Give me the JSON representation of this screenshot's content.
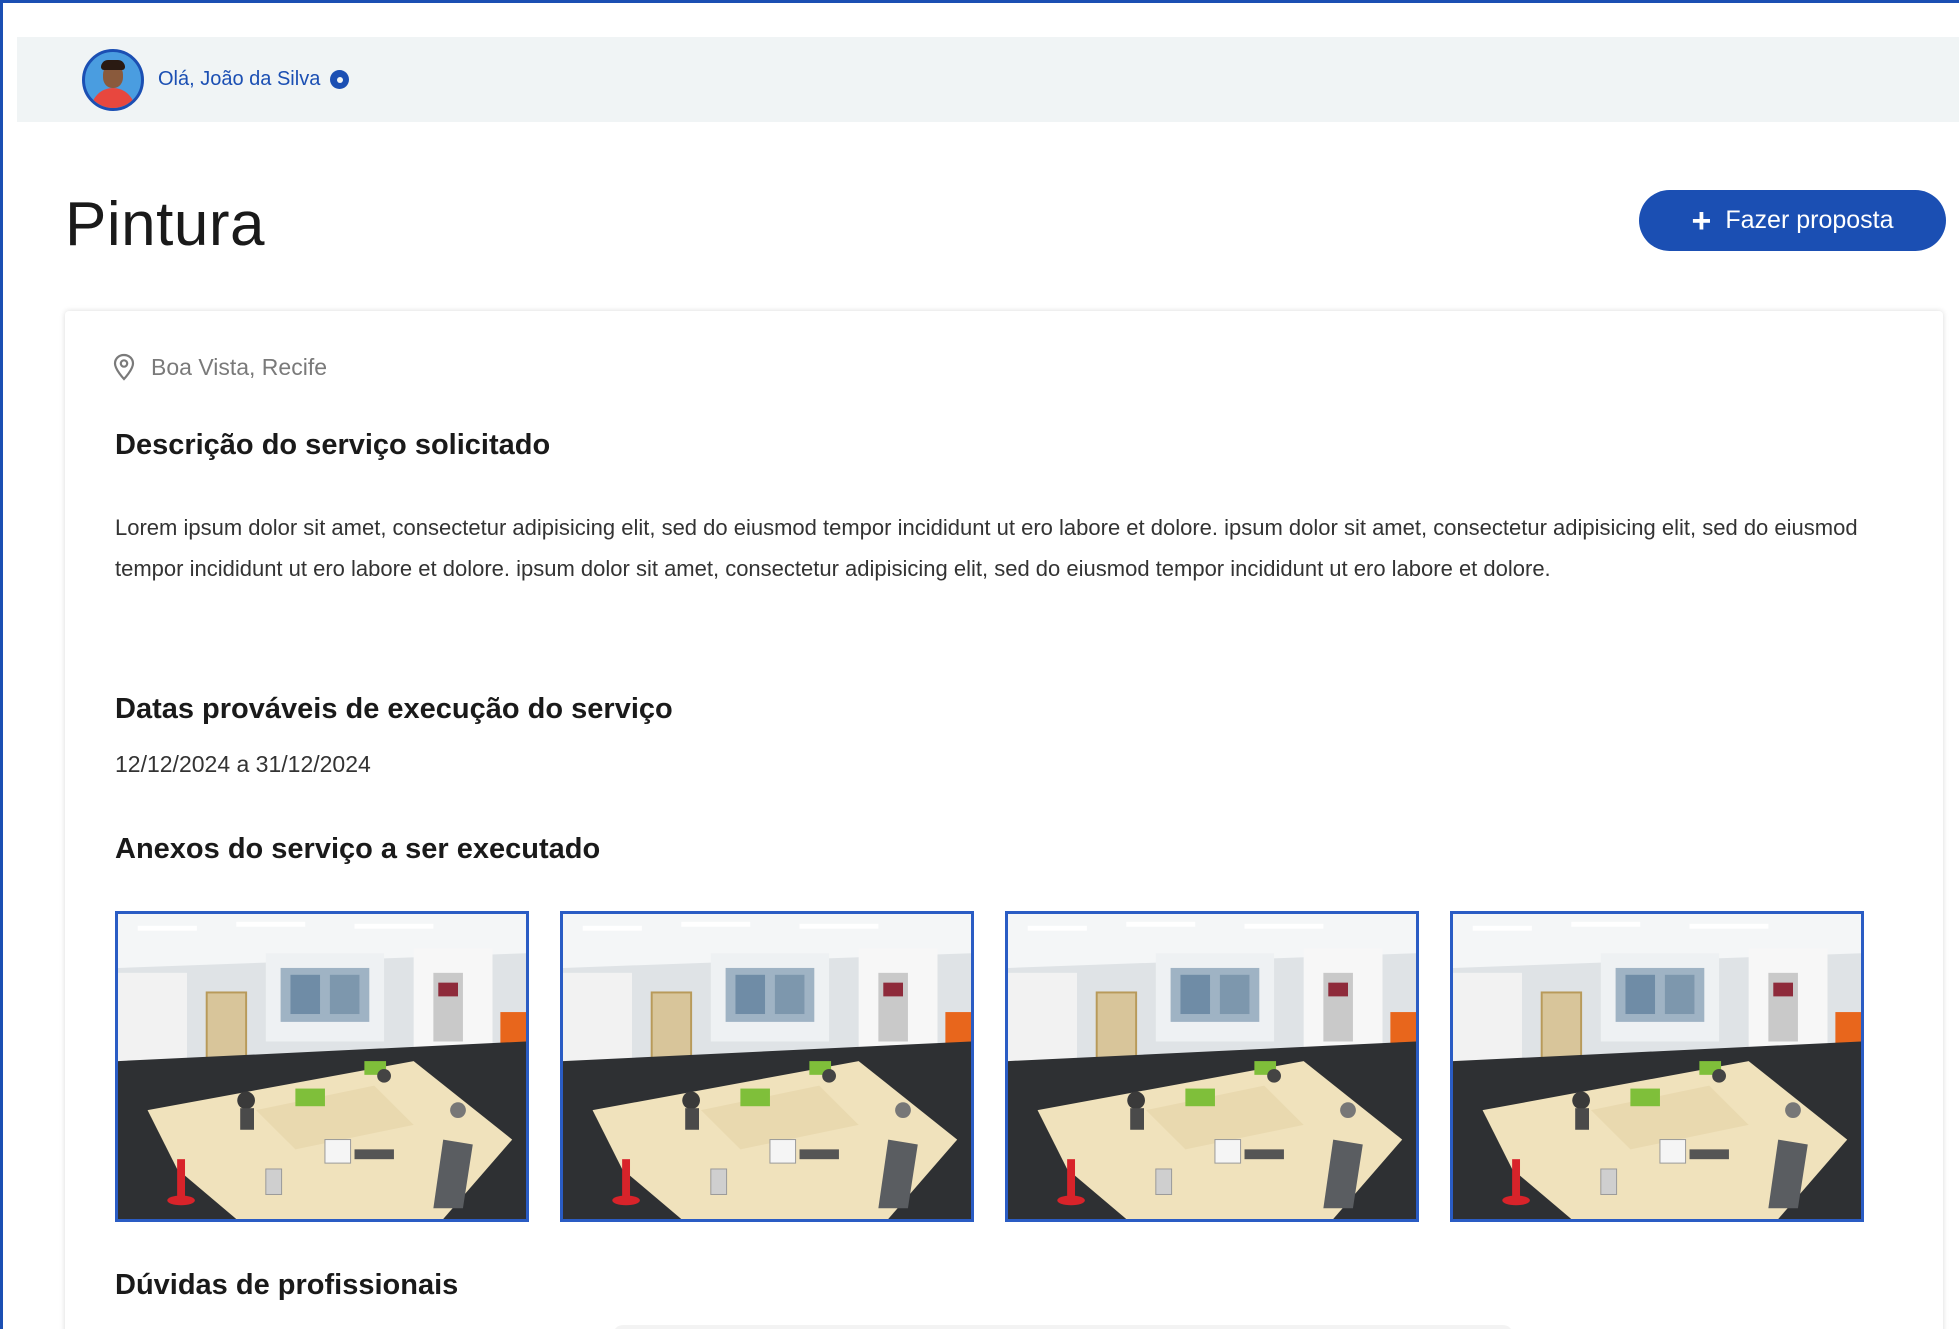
{
  "header": {
    "greeting": "Olá, João da Silva",
    "avatar_icon": "user-avatar",
    "verified_icon": "verified-badge-icon"
  },
  "page": {
    "title": "Pintura",
    "cta_label": "Fazer proposta",
    "cta_icon": "plus-icon"
  },
  "colors": {
    "primary": "#1b4fb3",
    "header_bg": "#f0f4f5",
    "muted_text": "#7a7a7a"
  },
  "details": {
    "location_icon": "location-pin-icon",
    "location": "Boa Vista, Recife",
    "description_heading": "Descrição do serviço solicitado",
    "description": "Lorem ipsum dolor sit amet, consectetur adipisicing elit, sed do eiusmod tempor incididunt ut ero labore et dolore.  ipsum dolor sit amet, consectetur adipisicing elit, sed do eiusmod tempor incididunt ut ero labore et dolore. ipsum dolor sit amet, consectetur adipisicing elit, sed do eiusmod tempor incididunt ut ero labore et dolore.",
    "dates_heading": "Datas prováveis de execução do serviço",
    "dates": "12/12/2024 a 31/12/2024",
    "attachments_heading": "Anexos do serviço a ser executado",
    "attachments": [
      {
        "name": "attachment-1"
      },
      {
        "name": "attachment-2"
      },
      {
        "name": "attachment-3"
      },
      {
        "name": "attachment-4"
      }
    ],
    "questions_heading": "Dúvidas de profissionais"
  }
}
